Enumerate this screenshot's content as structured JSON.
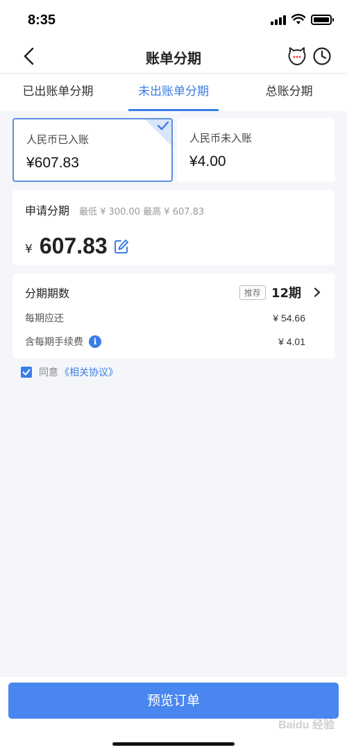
{
  "status_bar": {
    "time": "8:35"
  },
  "nav": {
    "title": "账单分期"
  },
  "tabs": [
    {
      "label": "已出账单分期",
      "active": false
    },
    {
      "label": "未出账单分期",
      "active": true
    },
    {
      "label": "总账分期",
      "active": false
    }
  ],
  "bill_cards": [
    {
      "label": "人民币已入账",
      "amount": "¥607.83",
      "selected": true
    },
    {
      "label": "人民币未入账",
      "amount": "¥4.00",
      "selected": false
    }
  ],
  "apply": {
    "title": "申请分期",
    "range": "最低 ¥ 300.00 最高 ¥ 607.83",
    "currency": "¥",
    "amount": "607.83"
  },
  "term": {
    "title": "分期期数",
    "badge": "推荐",
    "value": "12期",
    "per_period_label": "每期应还",
    "per_period_value": "¥ 54.66",
    "fee_label": "含每期手续费",
    "fee_info_icon": "i",
    "fee_value": "¥ 4.01"
  },
  "agreement": {
    "checked": true,
    "text": "同意",
    "link": "《相关协议》"
  },
  "footer": {
    "button_label": "预览订单"
  },
  "watermark": "Baidu 经验",
  "colors": {
    "accent": "#3b7de6",
    "button": "#4a86ef"
  }
}
